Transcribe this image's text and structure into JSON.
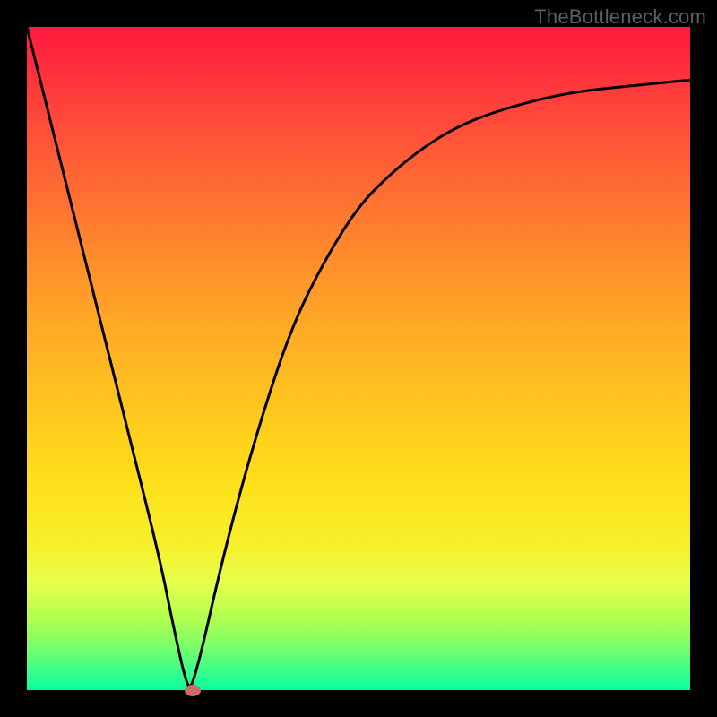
{
  "watermark": "TheBottleneck.com",
  "colors": {
    "gradient_top": "#ff1a3d",
    "gradient_mid": "#ffc31f",
    "gradient_bottom": "#00ff99",
    "curve": "#000000",
    "marker": "#cc6b6b",
    "frame": "#000000"
  },
  "chart_data": {
    "type": "line",
    "title": "",
    "xlabel": "",
    "ylabel": "",
    "xlim": [
      0,
      100
    ],
    "ylim": [
      0,
      100
    ],
    "legend": false,
    "grid": false,
    "series": [
      {
        "name": "curve",
        "x": [
          0,
          5,
          10,
          15,
          20,
          22,
          24,
          25,
          30,
          35,
          40,
          45,
          50,
          55,
          60,
          65,
          70,
          75,
          80,
          85,
          90,
          95,
          100
        ],
        "y": [
          100,
          80,
          60,
          40,
          20,
          10,
          1,
          0,
          22,
          40,
          55,
          65,
          73,
          78,
          82,
          85,
          87,
          88.5,
          89.7,
          90.5,
          91,
          91.5,
          92
        ]
      }
    ],
    "marker": {
      "x": 25,
      "y": 0
    },
    "annotations": []
  }
}
